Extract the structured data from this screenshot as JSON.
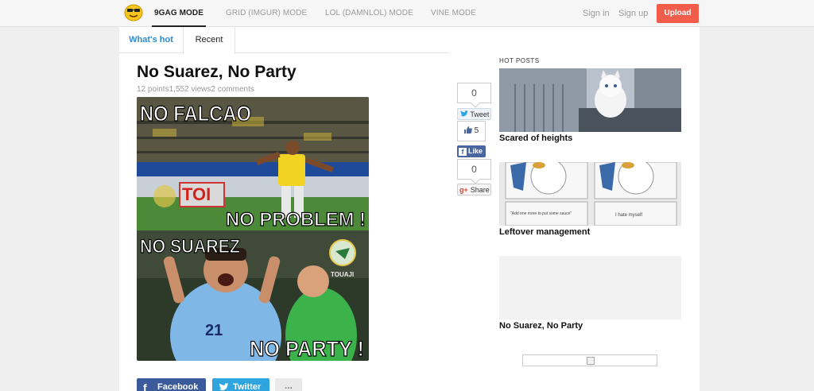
{
  "nav": {
    "modes": [
      "9GAG MODE",
      "GRID (IMGUR) MODE",
      "LOL (DAMNLOL) MODE",
      "VINE MODE"
    ],
    "sign_in": "Sign in",
    "sign_up": "Sign up",
    "upload": "Upload"
  },
  "tabs": {
    "whats_hot": "What's hot",
    "recent": "Recent"
  },
  "post": {
    "title": "No Suarez, No Party",
    "meta": "12 points1,552 views2 comments",
    "image_texts": {
      "top": "NO FALCAO",
      "mid": "NO PROBLEM !",
      "lower": "NO SUAREZ",
      "bottom": "NO PARTY !",
      "banner": "TOI",
      "badge": "TOUAJI",
      "jersey": "21"
    }
  },
  "social": {
    "tweet_count": "0",
    "tweet_label": "Tweet",
    "like_count": "5",
    "like_label": "Like",
    "gplus_count": "0",
    "share_label": "Share"
  },
  "bottom_share": {
    "facebook": "Facebook",
    "twitter": "Twitter",
    "more": "..."
  },
  "sidebar": {
    "heading": "HOT POSTS",
    "posts": [
      {
        "title": "Scared of heights"
      },
      {
        "title": "Leftover management"
      },
      {
        "title": "No Suarez, No Party"
      }
    ],
    "leftover_captions": [
      "\"Add one more to put some sauce\"",
      "I hate myself"
    ]
  },
  "colors": {
    "accent_blue": "#2f8bd0",
    "upload_red": "#f25c4a",
    "facebook": "#3b5a9a",
    "twitter": "#2fa5e0"
  }
}
